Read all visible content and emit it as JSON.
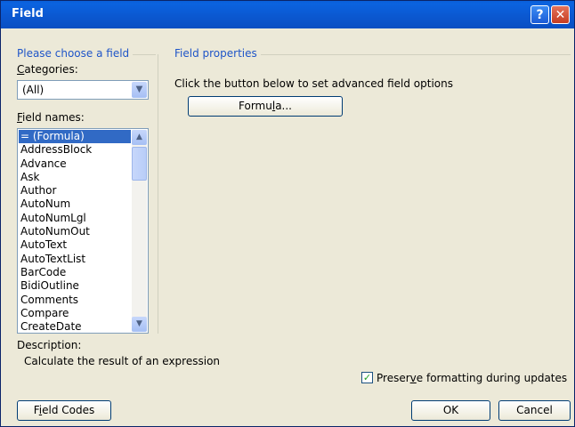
{
  "window": {
    "title": "Field",
    "help_glyph": "?",
    "close_glyph": "✕"
  },
  "left_group": {
    "title": "Please choose a field",
    "categories_label_key": "C",
    "categories_label_rest": "ategories:",
    "category_value": "(All)",
    "field_names_label_key": "F",
    "field_names_label_rest": "ield names:",
    "field_names": [
      "= (Formula)",
      "AddressBlock",
      "Advance",
      "Ask",
      "Author",
      "AutoNum",
      "AutoNumLgl",
      "AutoNumOut",
      "AutoText",
      "AutoTextList",
      "BarCode",
      "BidiOutline",
      "Comments",
      "Compare",
      "CreateDate"
    ],
    "selected_index": 0
  },
  "right_group": {
    "title": "Field properties",
    "instructions": "Click the button below to set advanced field options",
    "formula_pre": "Formu",
    "formula_key": "l",
    "formula_post": "a..."
  },
  "description": {
    "label": "Description:",
    "text": "Calculate the result of an expression"
  },
  "preserve": {
    "checked": true,
    "label_pre": "Preser",
    "label_key": "v",
    "label_post": "e formatting during updates"
  },
  "buttons": {
    "field_codes_key": "i",
    "field_codes_pre": "F",
    "field_codes_post": "eld Codes",
    "ok": "OK",
    "cancel": "Cancel"
  },
  "icons": {
    "dropdown": "chevron-down-icon",
    "scroll_up": "arrow-up-icon",
    "scroll_down": "arrow-down-icon",
    "check": "checkmark-icon"
  }
}
